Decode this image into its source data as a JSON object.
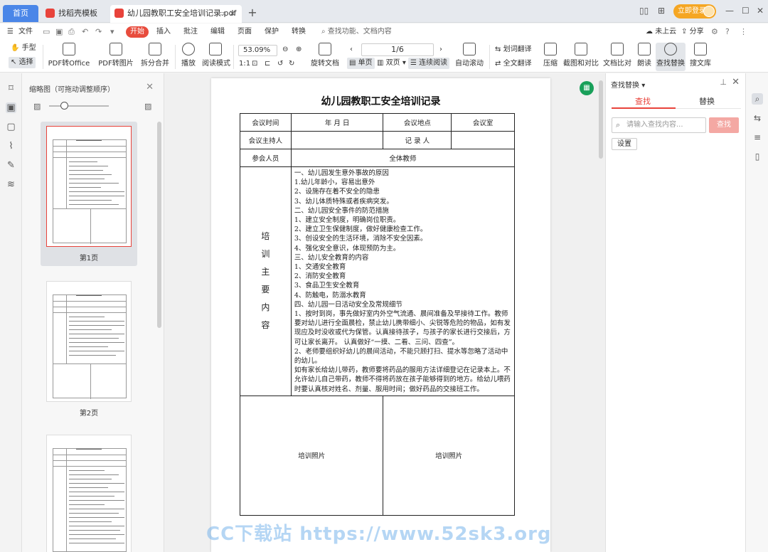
{
  "tabs": {
    "home": "首页",
    "template": "找稻壳模板",
    "document": "幼儿园教职工安全培训记录.pdf",
    "login": "立即登录"
  },
  "menu": {
    "file": "文件",
    "items": [
      "开始",
      "插入",
      "批注",
      "编辑",
      "页面",
      "保护",
      "转换"
    ],
    "search": "查找功能、文档内容",
    "cloud": "未上云",
    "share": "分享"
  },
  "ribbon": {
    "hand": "手型",
    "select": "选择",
    "pdf_to_office": "PDF转Office",
    "pdf_to_image": "PDF转图片",
    "split_merge": "拆分合并",
    "play": "播放",
    "read_mode": "阅读模式",
    "zoom": "53.09%",
    "rotate": "旋转文档",
    "page_indicator": "1/6",
    "single": "单页",
    "double": "双页",
    "continuous": "连续阅读",
    "auto_scroll": "自动滚动",
    "word_translate": "划词翻译",
    "full_translate": "全文翻译",
    "compress": "压缩",
    "screenshot": "截图和对比",
    "compare": "文档比对",
    "read_aloud": "朗读",
    "find_replace": "查找替换",
    "doc_search": "搜文库"
  },
  "thumb_panel": {
    "title": "缩略图（可拖动调整顺序）",
    "pages": [
      "第1页",
      "第2页"
    ]
  },
  "document": {
    "title": "幼儿园教职工安全培训记录",
    "label_time": "会议时间",
    "date_placeholder": "年    月    日",
    "label_place": "会议地点",
    "place": "会议室",
    "label_host": "会议主持人",
    "label_recorder": "记 录 人",
    "label_attendees": "参会人员",
    "attendees": "全体教师",
    "vertical_label": [
      "培",
      "训",
      "主",
      "要",
      "内",
      "容"
    ],
    "content_lines": [
      "一、幼儿园发生意外事故的原因",
      "1.幼儿年龄小，容易出意外",
      "2、设施存在着不安全的隐患",
      "3、幼儿体质特殊或者疾病突发。",
      "二、幼儿园安全事件的防范措施",
      "1、建立安全制度，明确岗位职责。",
      "2、建立卫生保健制度，做好健康检查工作。",
      "3、创设安全的生活环境，消除不安全因素。",
      "4、强化安全意识，体现预防为主。",
      "三、幼儿安全教育的内容",
      "1、交通安全教育",
      "2、消防安全教育",
      "3、食品卫生安全教育",
      "4、防触电，防溺水教育",
      "四、幼儿园一日活动安全及常规细节",
      "1、按时到岗，事先做好室内外空气流通、晨间准备及早接待工作。教师要对幼儿进行全面晨检，禁止幼儿携带细小、尖锐等危险的物品，如有发现应及时没收或代为保管。认真接待孩子，与孩子的家长进行交接后，方可让家长离开。 认真做好“一摸、二看、三问、四查”。",
      "2、老师要组织好幼儿的晨间活动，不能只顾打扫、提水等忽略了活动中的幼儿。",
      "如有家长给幼儿带药，教师要将药品的服用方法详细登记在记录本上。不允许幼儿自己带药，教师不得将药放在孩子能够得到的地方。给幼儿喂药时要认真核对姓名、剂量、服用时间；做好药品的交接班工作。"
    ],
    "photo_label": "培训照片"
  },
  "right_panel": {
    "title": "查找替换",
    "tab_find": "查找",
    "tab_replace": "替换",
    "search_placeholder": "请输入查找内容...",
    "find_button": "查找",
    "settings": "设置"
  },
  "watermark": "CC下载站 https://www.52sk3.org",
  "colors": {
    "accent": "#e8433b",
    "home_tab": "#4a86e8",
    "login": "#f5a623"
  }
}
